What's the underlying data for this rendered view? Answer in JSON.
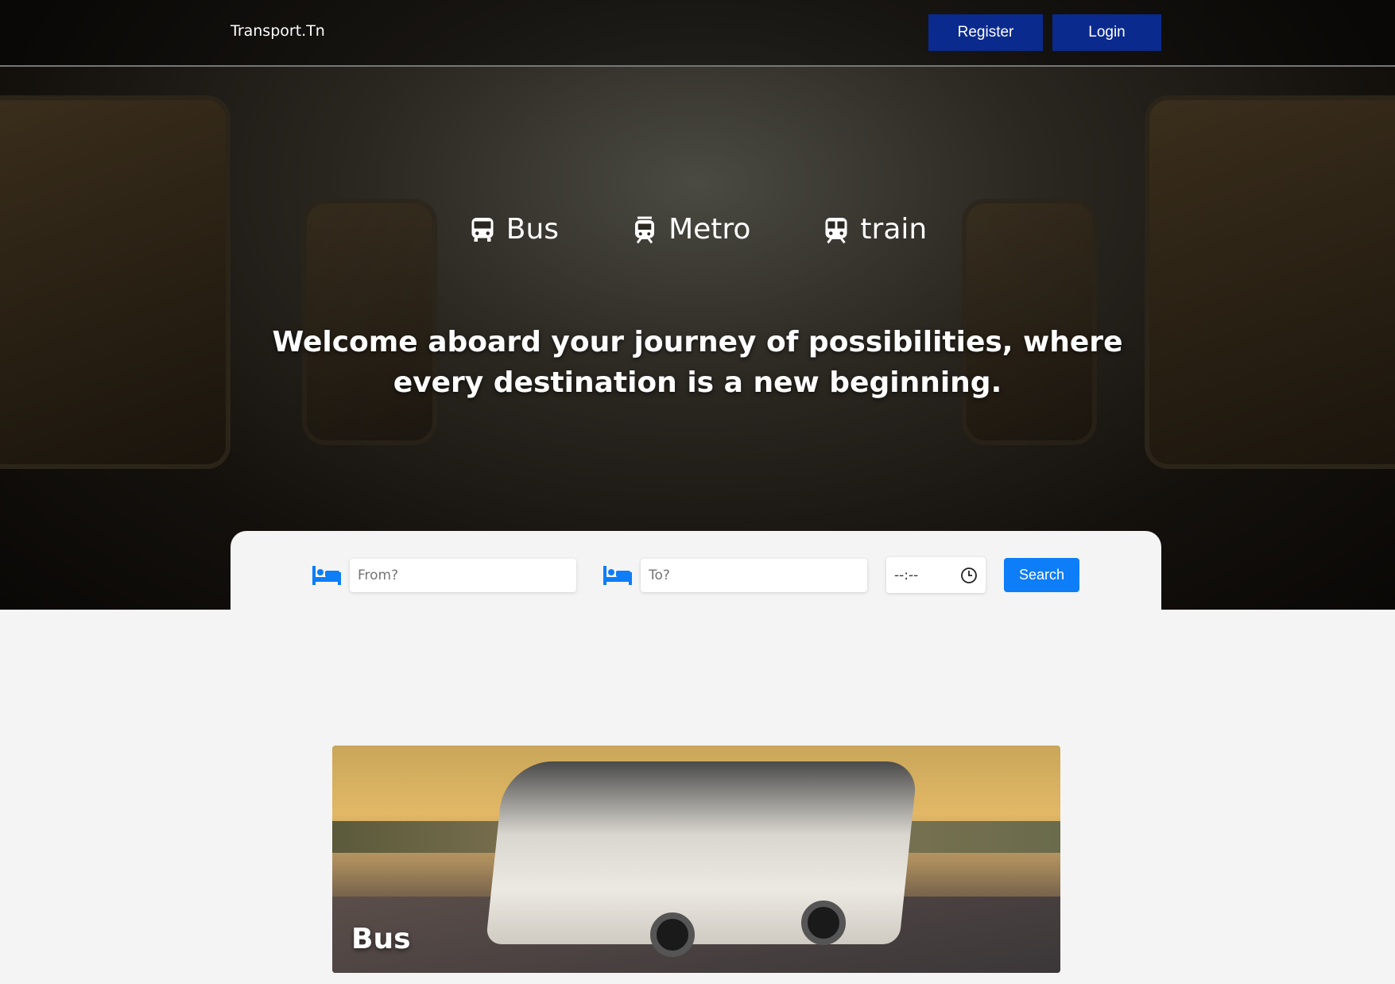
{
  "header": {
    "brand": "Transport.Tn",
    "register_label": "Register",
    "login_label": "Login"
  },
  "hero": {
    "modes": [
      {
        "label": "Bus",
        "icon": "bus-icon"
      },
      {
        "label": "Metro",
        "icon": "metro-icon"
      },
      {
        "label": "train",
        "icon": "train-icon"
      }
    ],
    "headline": "Welcome aboard your journey of possibilities, where every destination is a new beginning."
  },
  "search": {
    "from_placeholder": "From?",
    "to_placeholder": "To?",
    "time_value": "--:--",
    "search_label": "Search",
    "icon": "bed-icon",
    "accent": "#0d7df8"
  },
  "cards": [
    {
      "label": "Bus"
    }
  ],
  "colors": {
    "nav_button": "#0a2a8e",
    "page_bg": "#f4f4f4"
  }
}
